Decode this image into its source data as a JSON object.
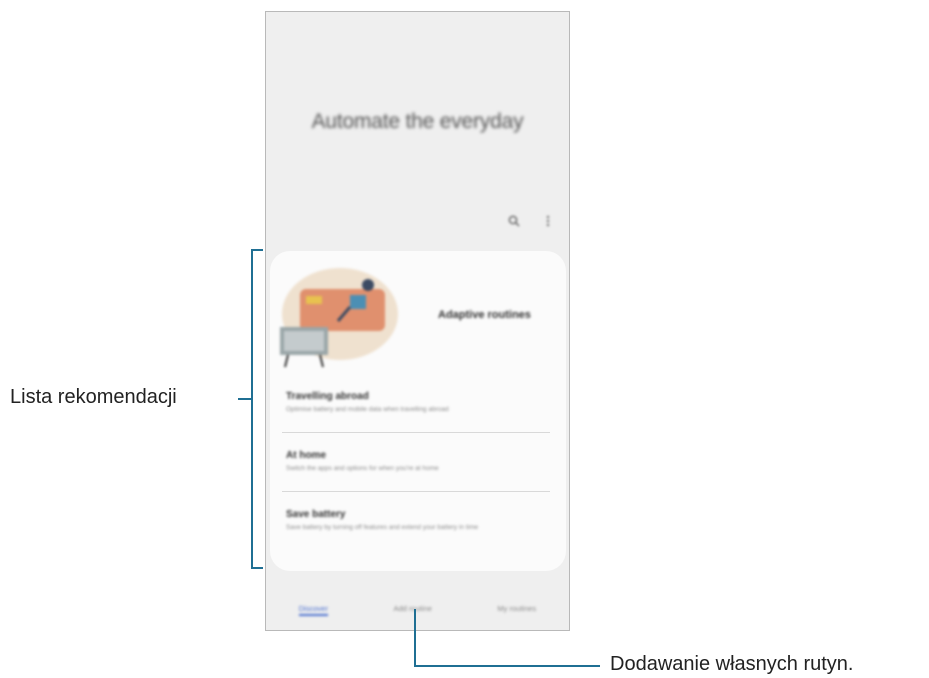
{
  "header": {
    "headline": "Automate the everyday"
  },
  "toolbar": {
    "search_icon": "search-icon",
    "more_icon": "more-vert-icon"
  },
  "card": {
    "title": "Adaptive routines",
    "items": [
      {
        "title": "Travelling abroad",
        "desc": "Optimise battery and mobile data when travelling abroad"
      },
      {
        "title": "At home",
        "desc": "Switch the apps and options for when you're at home"
      },
      {
        "title": "Save battery",
        "desc": "Save battery by turning off features and extend your battery in time"
      }
    ]
  },
  "bottom_nav": {
    "tabs": [
      "Discover",
      "Add routine",
      "My routines"
    ],
    "active": "Discover"
  },
  "annotations": {
    "left": "Lista rekomendacji",
    "bottom": "Dodawanie własnych rutyn."
  },
  "colors": {
    "accent": "#4a6fd0",
    "callout_line": "#1f6f93"
  }
}
